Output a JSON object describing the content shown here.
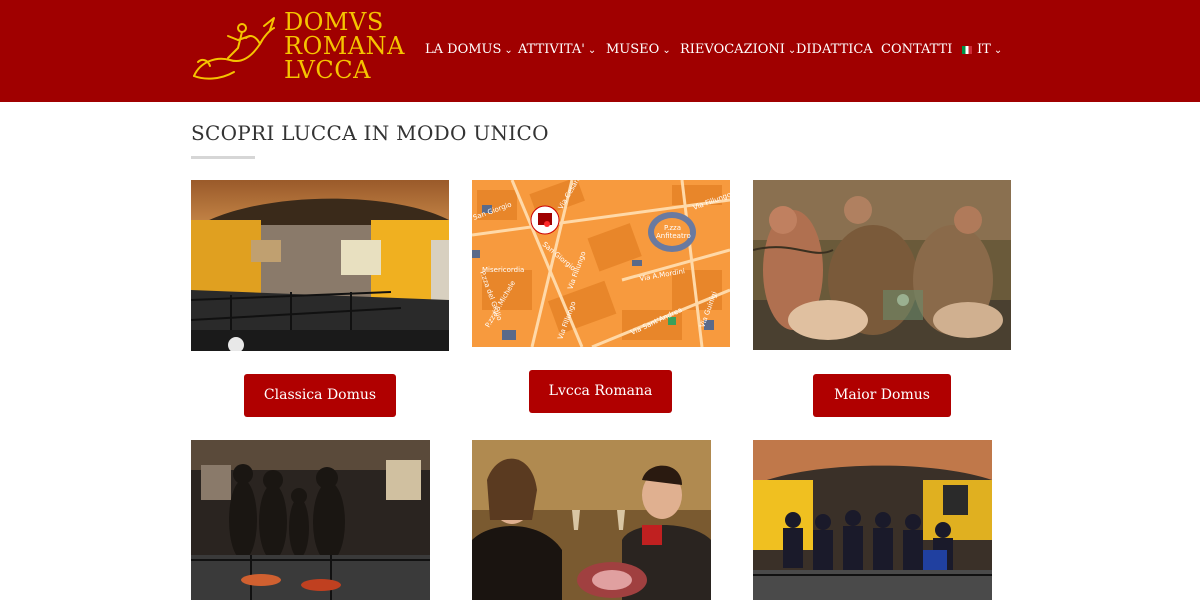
{
  "header": {
    "background": "#a00000",
    "logo": {
      "lines": [
        "DOMVS",
        "ROMANA",
        "LVCCA"
      ],
      "color": "#f5c400",
      "icon": "dolphin-rider-icon"
    },
    "nav": [
      {
        "label": "LA DOMUS",
        "has_dropdown": true
      },
      {
        "label": "ATTIVITA'",
        "has_dropdown": true
      },
      {
        "label": "MUSEO",
        "has_dropdown": true
      },
      {
        "label": "RIEVOCAZIONI",
        "has_dropdown": true
      },
      {
        "label": "DIDATTICA",
        "has_dropdown": false
      },
      {
        "label": "CONTATTI",
        "has_dropdown": false
      },
      {
        "label": "IT",
        "has_dropdown": true,
        "icon": "italian-flag-icon"
      }
    ]
  },
  "section": {
    "title": "SCOPRI LUCCA IN MODO UNICO"
  },
  "cards": [
    {
      "image": "underground-museum-room-photo",
      "button": "Classica Domus"
    },
    {
      "image": "lucca-street-map",
      "button": "Lvcca Romana",
      "map_labels": [
        "Via Cesare Battisti",
        "San Giorgio",
        "Via San Giorgio",
        "P.zza Anfiteatro",
        "Via Fillungo",
        "P.zza San Michele",
        "Via Fillungo",
        "Via A.Mordini",
        "Via Sant'Andrea",
        "Via Guinigi",
        "P.zza del Giglio",
        "Misericordia"
      ]
    },
    {
      "image": "roman-fresco-painting",
      "button": "Maior Domus"
    }
  ],
  "bottom_images": [
    {
      "image": "family-visitors-photo"
    },
    {
      "image": "couple-toasting-wine-photo"
    },
    {
      "image": "group-of-students-photo"
    }
  ],
  "colors": {
    "accent_red": "#b00000",
    "logo_gold": "#f5c400"
  }
}
